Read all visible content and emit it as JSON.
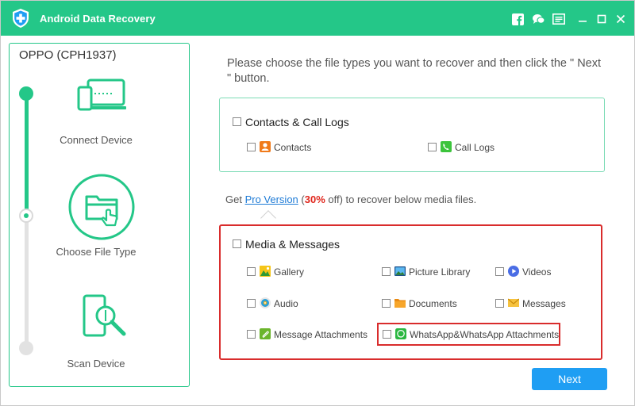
{
  "app": {
    "title": "Android Data Recovery"
  },
  "titlebar_icons": [
    {
      "name": "facebook-icon"
    },
    {
      "name": "chat-support-icon"
    },
    {
      "name": "feedback-icon"
    },
    {
      "name": "minimize-icon"
    },
    {
      "name": "maximize-icon"
    },
    {
      "name": "close-icon"
    }
  ],
  "sidebar": {
    "device": "OPPO (CPH1937)",
    "progress_step": 2,
    "progress_total": 3,
    "steps": [
      {
        "label": "Connect Device",
        "status": "done",
        "icon": "connect-device-icon"
      },
      {
        "label": "Choose File Type",
        "status": "current",
        "icon": "choose-file-type-icon"
      },
      {
        "label": "Scan Device",
        "status": "pending",
        "icon": "scan-device-icon"
      }
    ]
  },
  "main": {
    "instruction": "Please choose the file types you want to recover and then click the \" Next \" button.",
    "contacts_group": {
      "title": "Contacts & Call Logs",
      "checked": false,
      "items": [
        {
          "label": "Contacts",
          "icon": "contacts-icon",
          "checked": false
        },
        {
          "label": "Call Logs",
          "icon": "call-logs-icon",
          "checked": false
        }
      ]
    },
    "promo": {
      "prefix": "Get ",
      "link": "Pro Version",
      "open_paren": " (",
      "discount": "30%",
      "suffix": " off) to recover below media files."
    },
    "media_group": {
      "title": "Media & Messages",
      "checked": false,
      "items": [
        {
          "label": "Gallery",
          "icon": "gallery-icon",
          "checked": false
        },
        {
          "label": "Picture Library",
          "icon": "picture-library-icon",
          "checked": false
        },
        {
          "label": "Videos",
          "icon": "videos-icon",
          "checked": false
        },
        {
          "label": "Audio",
          "icon": "audio-icon",
          "checked": false
        },
        {
          "label": "Documents",
          "icon": "documents-icon",
          "checked": false
        },
        {
          "label": "Messages",
          "icon": "messages-icon",
          "checked": false
        },
        {
          "label": "Message Attachments",
          "icon": "message-attachments-icon",
          "checked": false
        },
        {
          "label": "WhatsApp&WhatsApp Attachments",
          "icon": "whatsapp-icon",
          "checked": false
        }
      ]
    },
    "next_button": "Next"
  },
  "colors": {
    "brand_green": "#24c788",
    "highlight_red": "#d92c2c",
    "button_blue": "#1f9ef3",
    "link_blue": "#1e7bd6"
  }
}
